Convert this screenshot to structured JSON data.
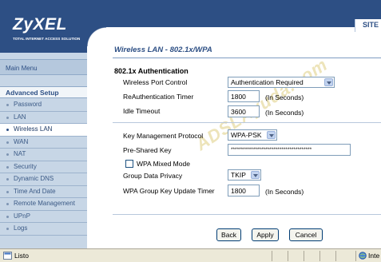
{
  "brand": {
    "name": "ZyXEL",
    "tagline": "TOTAL INTERNET ACCESS SOLUTION"
  },
  "header": {
    "site_label": "SITE"
  },
  "sidebar": {
    "main_menu": "Main Menu",
    "section": "Advanced Setup",
    "items": [
      {
        "label": "Password"
      },
      {
        "label": "LAN"
      },
      {
        "label": "Wireless LAN"
      },
      {
        "label": "WAN"
      },
      {
        "label": "NAT"
      },
      {
        "label": "Security"
      },
      {
        "label": "Dynamic DNS"
      },
      {
        "label": "Time And Date"
      },
      {
        "label": "Remote Management"
      },
      {
        "label": "UPnP"
      },
      {
        "label": "Logs"
      }
    ],
    "active": "Wireless LAN"
  },
  "page": {
    "title": "Wireless LAN - 802.1x/WPA",
    "section_title": "802.1x Authentication",
    "wireless_port_control": {
      "label": "Wireless Port Control",
      "value": "Authentication Required"
    },
    "reauth_timer": {
      "label": "ReAuthentication Timer",
      "value": "1800",
      "unit": "(In Seconds)"
    },
    "idle_timeout": {
      "label": "Idle Timeout",
      "value": "3600",
      "unit": "(In Seconds)"
    },
    "key_mgmt": {
      "label": "Key Management Protocol",
      "value": "WPA-PSK"
    },
    "psk": {
      "label": "Pre-Shared Key",
      "value": "****************************************"
    },
    "wpa_mixed": {
      "label": "WPA Mixed Mode",
      "checked": false
    },
    "group_privacy": {
      "label": "Group Data Privacy",
      "value": "TKIP"
    },
    "group_key_timer": {
      "label": "WPA Group Key Update Timer",
      "value": "1800",
      "unit": "(In Seconds)"
    },
    "watermark": "ADSLAyuda.com"
  },
  "buttons": {
    "back": "Back",
    "apply": "Apply",
    "cancel": "Cancel"
  },
  "statusbar": {
    "status": "Listo",
    "zone": "Inte"
  },
  "colors": {
    "brand_blue": "#2d4f84",
    "sidebar_bg": "#c7d6e6",
    "statusbar_bg": "#ece9d8"
  }
}
